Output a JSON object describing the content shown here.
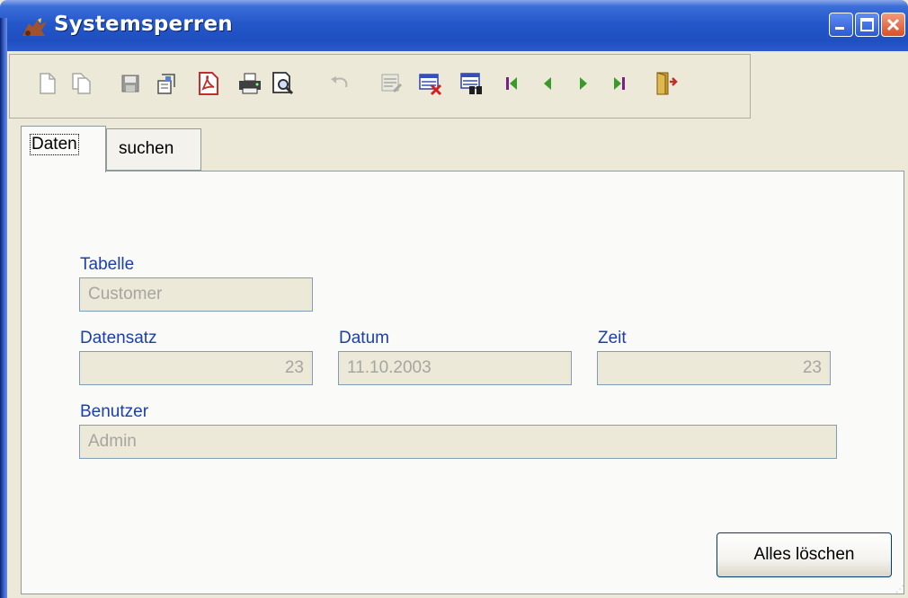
{
  "window": {
    "title": "Systemsperren",
    "title_icon": "app-icon",
    "controls": [
      "minimize-icon",
      "maximize-icon",
      "close-icon"
    ]
  },
  "toolbar": {
    "buttons": [
      "new-document-icon",
      "copy-document-icon",
      "save-icon",
      "properties-icon",
      "pdf-icon",
      "print-icon",
      "print-preview-icon",
      "undo-icon",
      "edit-record-icon",
      "delete-record-icon",
      "search-record-icon",
      "first-record-icon",
      "previous-record-icon",
      "next-record-icon",
      "last-record-icon",
      "exit-icon"
    ]
  },
  "tabs": [
    {
      "label": "Daten",
      "active": true
    },
    {
      "label": "suchen",
      "active": false
    }
  ],
  "form": {
    "tabelle": {
      "label": "Tabelle",
      "value": "Customer"
    },
    "datensatz": {
      "label": "Datensatz",
      "value": "23"
    },
    "datum": {
      "label": "Datum",
      "value": "11.10.2003"
    },
    "zeit": {
      "label": "Zeit",
      "value": "23"
    },
    "benutzer": {
      "label": "Benutzer",
      "value": "Admin"
    }
  },
  "actions": {
    "clear_all": "Alles löschen"
  },
  "colors": {
    "titlebar": "#2457c9",
    "label": "#1c3fa8",
    "field_bg": "#ECE9D8",
    "field_border": "#7F9DB9",
    "nav_green": "#3a9a2a",
    "nav_purple": "#7a1f8a"
  }
}
